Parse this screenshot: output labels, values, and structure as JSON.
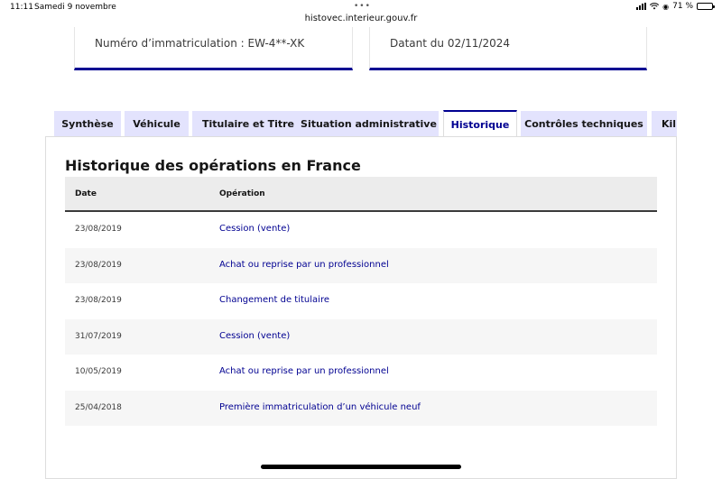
{
  "status_bar": {
    "time": "11:11",
    "date": "Samedi 9 novembre",
    "url": "histovec.interieur.gouv.fr",
    "battery": "71 %",
    "battery_level": 0.71
  },
  "cards": {
    "plate": "Numéro d’immatriculation : EW-4**-XK",
    "date": "Datant du 02/11/2024"
  },
  "tabs": [
    {
      "label": "Synthèse"
    },
    {
      "label": "Véhicule"
    },
    {
      "label": "Titulaire et Titre"
    },
    {
      "label": "Situation administrative"
    },
    {
      "label": "Historique",
      "active": true
    },
    {
      "label": "Contrôles techniques"
    },
    {
      "label": "Kil"
    }
  ],
  "history": {
    "title": "Historique des opérations en France",
    "columns": {
      "date": "Date",
      "operation": "Opération"
    },
    "rows": [
      {
        "date": "23/08/2019",
        "operation": "Cession (vente)"
      },
      {
        "date": "23/08/2019",
        "operation": "Achat ou reprise par un professionnel"
      },
      {
        "date": "23/08/2019",
        "operation": "Changement de titulaire"
      },
      {
        "date": "31/07/2019",
        "operation": "Cession (vente)"
      },
      {
        "date": "10/05/2019",
        "operation": "Achat ou reprise par un professionnel"
      },
      {
        "date": "25/04/2018",
        "operation": "Première immatriculation d’un véhicule neuf"
      }
    ]
  },
  "colors": {
    "accent": "#000091",
    "tab_bg": "#e3e3fd"
  }
}
